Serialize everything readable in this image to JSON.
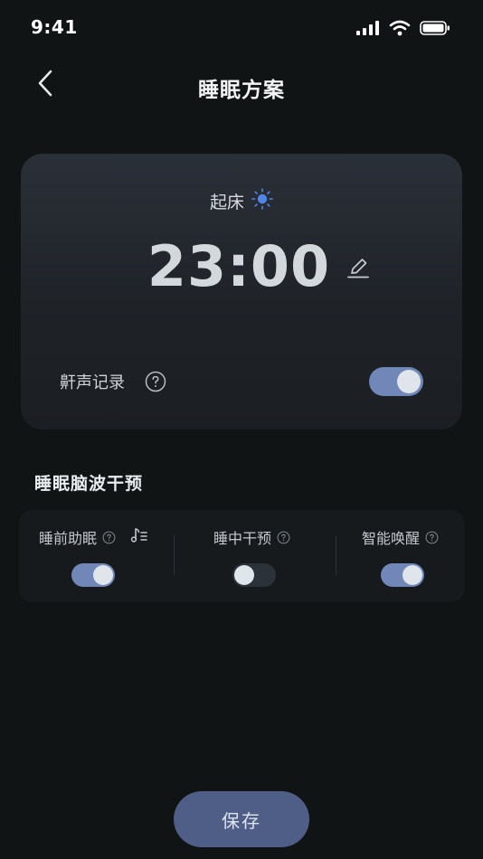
{
  "status_bar": {
    "time": "9:41"
  },
  "header": {
    "title": "睡眠方案"
  },
  "alarm_card": {
    "wake_label": "起床",
    "time": "23:00",
    "snore_label": "鼾声记录",
    "snore_enabled": true
  },
  "section": {
    "title": "睡眠脑波干预",
    "features": [
      {
        "label": "睡前助眠",
        "enabled": true
      },
      {
        "label": "睡中干预",
        "enabled": false
      },
      {
        "label": "智能唤醒",
        "enabled": true
      }
    ]
  },
  "footer": {
    "save_label": "保存"
  },
  "colors": {
    "background": "#101415",
    "card": "#24282e",
    "toggle_on": "#7087b8",
    "toggle_off": "#2c3239",
    "save_button": "#4f5e86",
    "sun_icon": "#4f86e8"
  }
}
